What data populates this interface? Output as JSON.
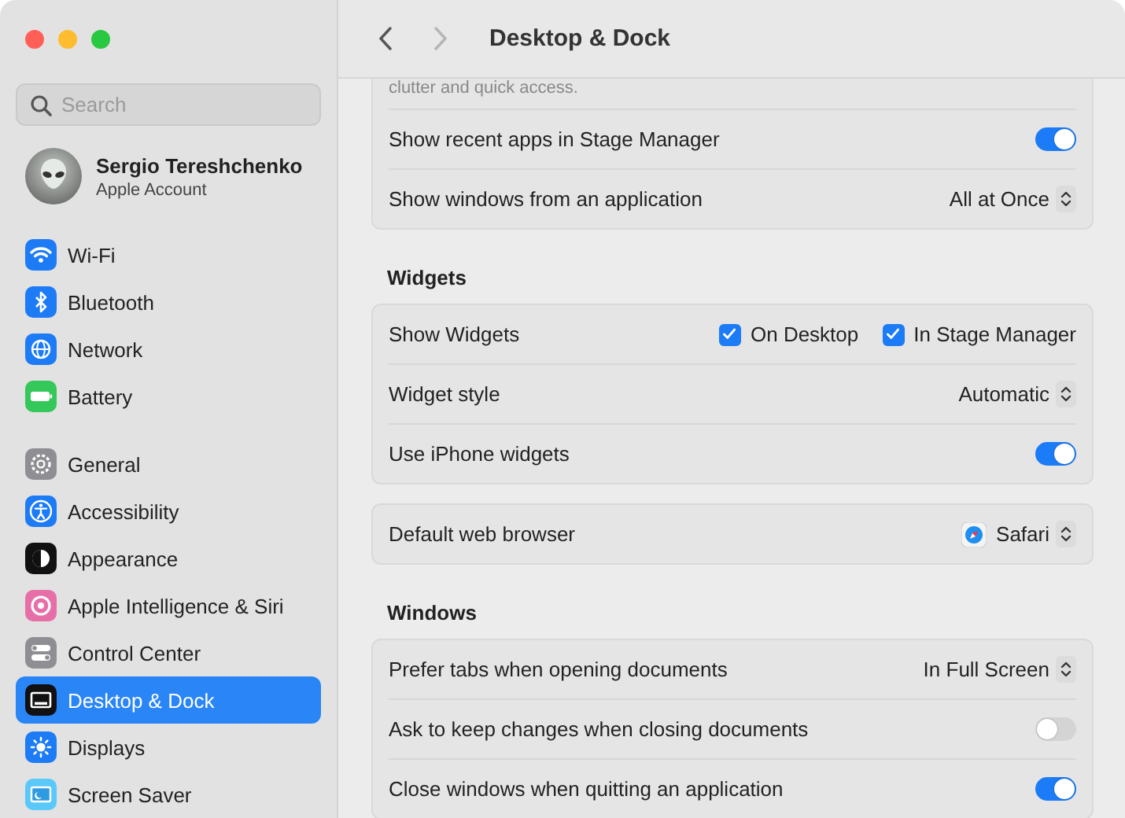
{
  "window": {
    "title": "Desktop & Dock",
    "back": {
      "disabled": false
    },
    "forward": {
      "disabled": true
    }
  },
  "sidebar": {
    "search": {
      "placeholder": "Search"
    },
    "account": {
      "name": "Sergio Tereshchenko",
      "subtitle": "Apple Account"
    },
    "groups": [
      {
        "items": [
          {
            "label": "Wi-Fi",
            "kind": "wifi",
            "selected": false
          },
          {
            "label": "Bluetooth",
            "kind": "bluetooth",
            "selected": false
          },
          {
            "label": "Network",
            "kind": "network",
            "selected": false
          },
          {
            "label": "Battery",
            "kind": "battery",
            "selected": false
          }
        ]
      },
      {
        "items": [
          {
            "label": "General",
            "kind": "general",
            "selected": false
          },
          {
            "label": "Accessibility",
            "kind": "accessibility",
            "selected": false
          },
          {
            "label": "Appearance",
            "kind": "appearance",
            "selected": false
          },
          {
            "label": "Apple Intelligence & Siri",
            "kind": "siri",
            "selected": false
          },
          {
            "label": "Control Center",
            "kind": "control",
            "selected": false
          },
          {
            "label": "Desktop & Dock",
            "kind": "desktop",
            "selected": true
          },
          {
            "label": "Displays",
            "kind": "displays",
            "selected": false
          },
          {
            "label": "Screen Saver",
            "kind": "screensaver",
            "selected": false
          }
        ]
      }
    ]
  },
  "content": {
    "groups": [
      {
        "rows": [
          {
            "kind": "note",
            "text": "clutter and quick access."
          },
          {
            "kind": "toggle",
            "label": "Show recent apps in Stage Manager",
            "on": true
          },
          {
            "kind": "popup",
            "label": "Show windows from an application",
            "value": "All at Once"
          }
        ]
      },
      {
        "heading": "Widgets",
        "rows": [
          {
            "kind": "checks",
            "label": "Show Widgets",
            "options": [
              {
                "label": "On Desktop",
                "checked": true
              },
              {
                "label": "In Stage Manager",
                "checked": true
              }
            ]
          },
          {
            "kind": "popup",
            "label": "Widget style",
            "value": "Automatic"
          },
          {
            "kind": "toggle",
            "label": "Use iPhone widgets",
            "on": true
          }
        ]
      },
      {
        "rows": [
          {
            "kind": "app_popup",
            "label": "Default web browser",
            "value": "Safari"
          }
        ]
      },
      {
        "heading": "Windows",
        "rows": [
          {
            "kind": "popup",
            "label": "Prefer tabs when opening documents",
            "value": "In Full Screen"
          },
          {
            "kind": "toggle",
            "label": "Ask to keep changes when closing documents",
            "on": false
          },
          {
            "kind": "toggle",
            "label": "Close windows when quitting an application",
            "on": true
          }
        ]
      }
    ]
  }
}
